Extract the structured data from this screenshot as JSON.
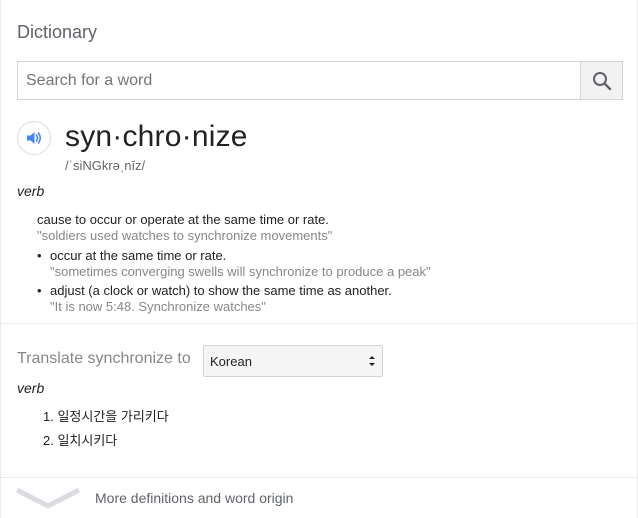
{
  "header": {
    "title": "Dictionary"
  },
  "search": {
    "placeholder": "Search for a word",
    "value": ""
  },
  "entry": {
    "word": "syn·chro·nize",
    "phonetic": "/ˈsiNGkrəˌnīz/",
    "part_of_speech": "verb",
    "main_definition": {
      "text": "cause to occur or operate at the same time or rate.",
      "example": "\"soldiers used watches to synchronize movements\""
    },
    "sub_definitions": [
      {
        "text": "occur at the same time or rate.",
        "example": "\"sometimes converging swells will synchronize to produce a peak\""
      },
      {
        "text": "adjust (a clock or watch) to show the same time as another.",
        "example": "\"It is now 5:48. Synchronize watches\""
      }
    ]
  },
  "translate": {
    "label": "Translate synchronize to",
    "language": "Korean",
    "part_of_speech": "verb",
    "items": [
      "1. 일정시간을 가리키다",
      "2. 일치시키다"
    ]
  },
  "footer": {
    "more_label": "More definitions and word origin"
  },
  "colors": {
    "speaker_blue": "#4285f4",
    "muted_text": "#878787"
  },
  "icons": {
    "search": "search-icon",
    "speaker": "speaker-icon",
    "expand": "chevron-down-icon"
  }
}
